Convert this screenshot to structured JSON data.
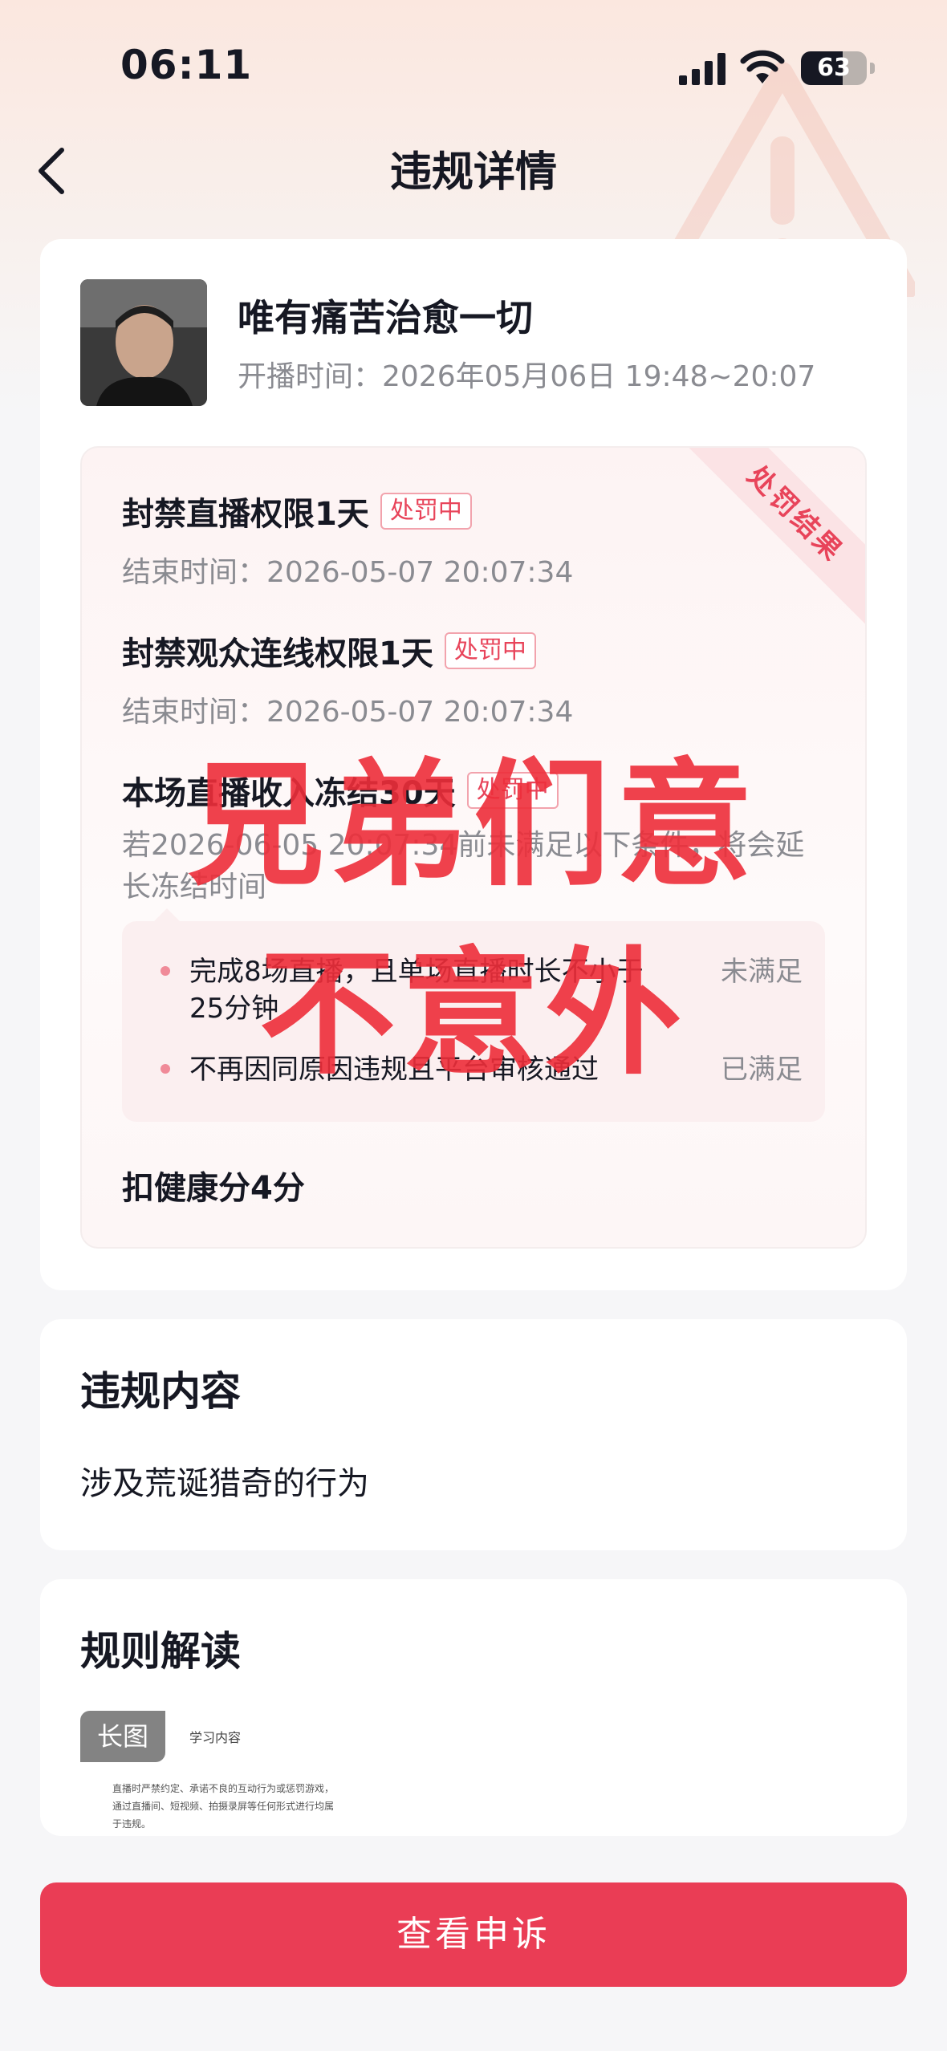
{
  "status_bar": {
    "time": "06:11",
    "battery": "63",
    "battery_level": 0.63
  },
  "nav": {
    "title": "违规详情"
  },
  "streamer": {
    "name": "唯有痛苦治愈一切",
    "live_time": "开播时间：2026年05月06日 19:48~20:07"
  },
  "penalty": {
    "ribbon": "处罚结果",
    "items": [
      {
        "title": "封禁直播权限1天",
        "badge": "处罚中",
        "sub": "结束时间：2026-05-07 20:07:34"
      },
      {
        "title": "封禁观众连线权限1天",
        "badge": "处罚中",
        "sub": "结束时间：2026-05-07 20:07:34"
      },
      {
        "title": "本场直播收入冻结30天",
        "badge": "处罚中",
        "sub": "若2026-06-05 20:07:34前未满足以下条件，将会延长冻结时间"
      }
    ],
    "conditions": [
      {
        "text": "完成8场直播，且单场直播时长不小于25分钟",
        "status": "未满足"
      },
      {
        "text": "不再因同原因违规且平台审核通过",
        "status": "已满足"
      }
    ],
    "health": "扣健康分4分"
  },
  "overlay": {
    "line1": "兄弟们意",
    "line2": "不意外"
  },
  "violation": {
    "title": "违规内容",
    "content": "涉及荒诞猎奇的行为"
  },
  "rules": {
    "title": "规则解读",
    "tag": "长图",
    "thumb_header": "学习内容",
    "thumb_lines": [
      "直播时严禁约定、承诺不良的互动行为或惩罚游戏，",
      "通过直播间、短视频、拍摄录屏等任何形式进行均属",
      "于违规。"
    ]
  },
  "footer": {
    "button": "查看申诉"
  },
  "colors": {
    "accent": "#ea3d55",
    "badge": "#e8445a",
    "overlay": "#ee2e3a"
  }
}
